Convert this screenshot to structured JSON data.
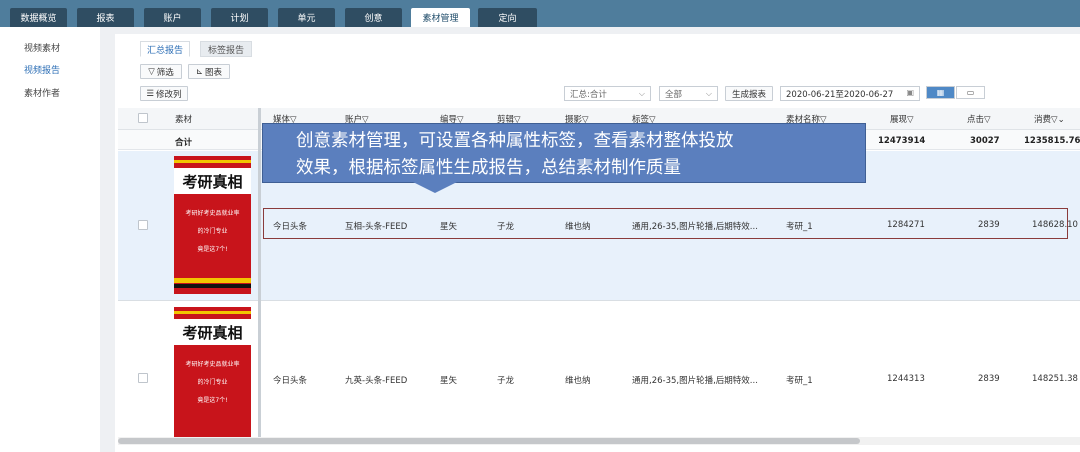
{
  "nav": {
    "tabs": [
      {
        "label": "数据概览"
      },
      {
        "label": "报表"
      },
      {
        "label": "账户"
      },
      {
        "label": "计划"
      },
      {
        "label": "单元"
      },
      {
        "label": "创意"
      },
      {
        "label": "素材管理"
      },
      {
        "label": "定向"
      }
    ]
  },
  "sidebar": {
    "items": [
      {
        "label": "视频素材"
      },
      {
        "label": "视频报告"
      },
      {
        "label": "素材作者"
      }
    ]
  },
  "subtabs": [
    {
      "label": "汇总报告"
    },
    {
      "label": "标签报告"
    }
  ],
  "toolbar": {
    "filter": "筛选",
    "chart": "图表",
    "edit_columns": "修改列",
    "summary_select": "汇总:合计",
    "all_select": "全部",
    "generate_report": "生成报表",
    "date_range": "2020-06-21至2020-06-27"
  },
  "table": {
    "headers": {
      "material": "素材",
      "media": "媒体",
      "account": "账户",
      "editor": "编导",
      "cutter": "剪辑",
      "camera": "摄影",
      "tags": "标签",
      "name": "素材名称",
      "impressions": "展现",
      "clicks": "点击",
      "cost": "消费"
    },
    "total": {
      "label": "合计",
      "impressions": "12473914",
      "clicks": "30027",
      "cost": "1235815.76"
    },
    "rows": [
      {
        "media": "今日头条",
        "account": "互相-头条-FEED",
        "editor": "星矢",
        "cutter": "子龙",
        "camera": "维也纳",
        "tags": "通用,26-35,图片轮播,后期特效...",
        "name": "考研_1",
        "impressions": "1284271",
        "clicks": "2839",
        "cost": "148628.10",
        "thumb_title": "考研真相",
        "thumb_lines": [
          "考研好考史品就业率",
          "的冷门专业",
          "竟是这7个!"
        ]
      },
      {
        "media": "今日头条",
        "account": "九英-头条-FEED",
        "editor": "星矢",
        "cutter": "子龙",
        "camera": "维也纳",
        "tags": "通用,26-35,图片轮播,后期特效...",
        "name": "考研_1",
        "impressions": "1244313",
        "clicks": "2839",
        "cost": "148251.38",
        "thumb_title": "考研真相",
        "thumb_lines": [
          "考研好考史品就业率",
          "的冷门专业",
          "竟是这7个!"
        ]
      }
    ]
  },
  "callout": {
    "line1": "创意素材管理，可设置各种属性标签，查看素材整体投放",
    "line2": "效果，根据标签属性生成报告，总结素材制作质量"
  },
  "colors": {
    "accent": "#2d6fb6",
    "topbar": "#4f7d9c",
    "callout": "#5b7fbe"
  }
}
